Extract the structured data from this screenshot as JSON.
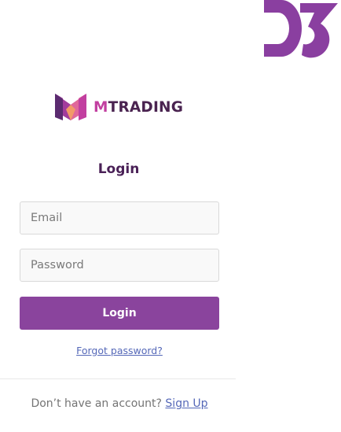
{
  "brand": {
    "name_m": "M",
    "name_rest": "TRADING",
    "logo_icon": "mtrading-logo-icon",
    "colors": {
      "purple_dark": "#4a2350",
      "purple_accent": "#8a449d",
      "magenta": "#c23fa0",
      "link": "#5568b8"
    }
  },
  "login": {
    "title": "Login",
    "email_placeholder": "Email",
    "password_placeholder": "Password",
    "button_label": "Login",
    "forgot_link": "Forgot password?"
  },
  "footer": {
    "prompt": "Don’t have an account?",
    "signup_link": "Sign Up"
  }
}
